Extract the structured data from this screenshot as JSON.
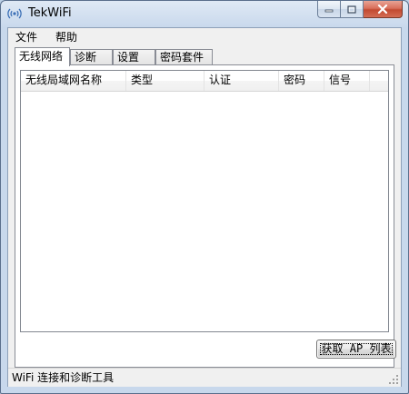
{
  "window": {
    "title": "TekWiFi",
    "app_icon": "wifi-signal-icon",
    "caption_buttons": [
      "minimize-icon",
      "maximize-icon",
      "close-icon"
    ]
  },
  "menubar": {
    "items": [
      {
        "label": "文件"
      },
      {
        "label": "帮助"
      }
    ]
  },
  "tabs": [
    {
      "label": "无线网络",
      "active": true
    },
    {
      "label": "诊断",
      "active": false
    },
    {
      "label": "设置",
      "active": false
    },
    {
      "label": "密码套件",
      "active": false
    }
  ],
  "ap_list": {
    "columns": [
      "无线局域网名称",
      "类型",
      "认证",
      "密码",
      "信号"
    ],
    "rows": []
  },
  "actions": {
    "get_ap_list_label": "获取 AP 列表"
  },
  "statusbar": {
    "text": "WiFi 连接和诊断工具"
  },
  "colors": {
    "frame": "#c8d8ec",
    "close_button": "#c24a31",
    "panel": "#f0f0f0"
  }
}
